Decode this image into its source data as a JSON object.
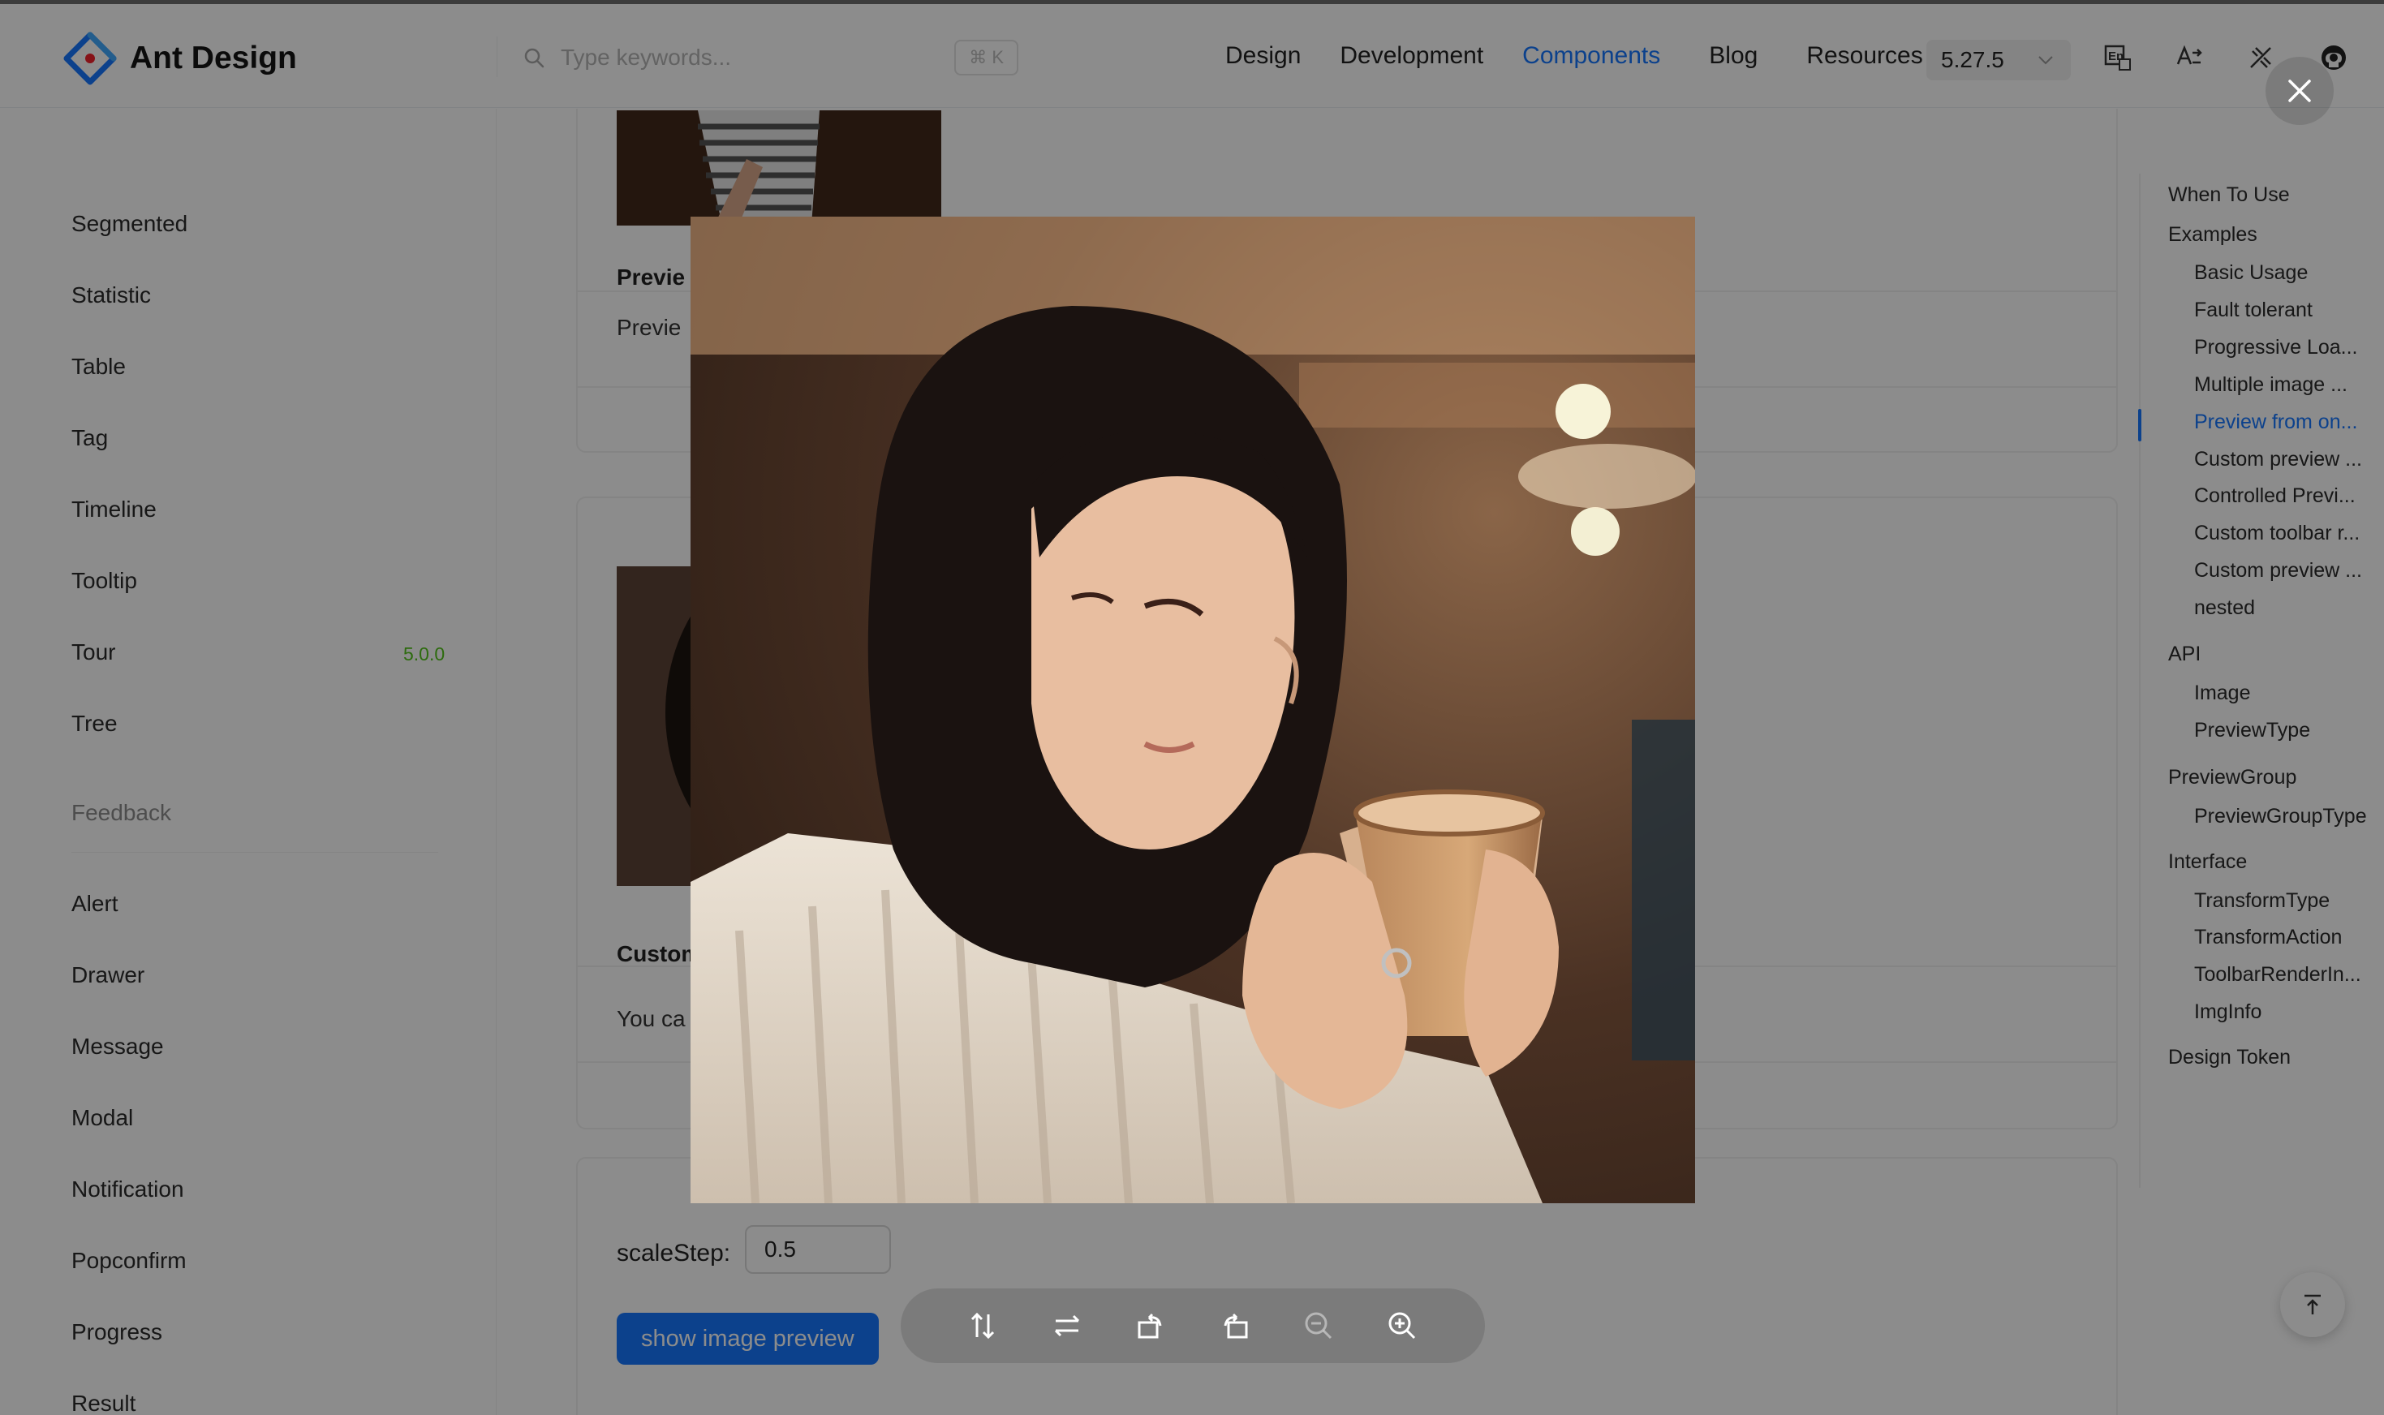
{
  "header": {
    "logo_text": "Ant Design",
    "search_placeholder": "Type keywords...",
    "search_shortcut": "⌘ K",
    "nav": [
      "Design",
      "Development",
      "Components",
      "Blog",
      "Resources"
    ],
    "nav_active": "Components",
    "version": "5.27.5",
    "icons": [
      "language-switch-icon",
      "direction-icon",
      "theme-icon",
      "github-icon"
    ]
  },
  "sidebar": {
    "items": [
      "Segmented",
      "Statistic",
      "Table",
      "Tag",
      "Timeline",
      "Tooltip",
      "Tour",
      "Tree"
    ],
    "tour_badge": "5.0.0",
    "group": "Feedback",
    "feedback_items": [
      "Alert",
      "Drawer",
      "Message",
      "Modal",
      "Notification",
      "Popconfirm",
      "Progress",
      "Result"
    ]
  },
  "content": {
    "demo1": {
      "title": "Previe",
      "desc": "Previe"
    },
    "demo2": {
      "title": "Custom",
      "desc": "You ca"
    },
    "scale_label": "scaleStep:",
    "scale_value": "0.5",
    "preview_button": "show image preview"
  },
  "toc": {
    "items": [
      {
        "label": "When To Use",
        "level": 1
      },
      {
        "label": "Examples",
        "level": 1
      },
      {
        "label": "Basic Usage",
        "level": 2
      },
      {
        "label": "Fault tolerant",
        "level": 2
      },
      {
        "label": "Progressive Loa...",
        "level": 2
      },
      {
        "label": "Multiple image ...",
        "level": 2
      },
      {
        "label": "Preview from on...",
        "level": 2,
        "active": true
      },
      {
        "label": "Custom preview ...",
        "level": 2
      },
      {
        "label": "Controlled Previ...",
        "level": 2
      },
      {
        "label": "Custom toolbar r...",
        "level": 2
      },
      {
        "label": "Custom preview ...",
        "level": 2
      },
      {
        "label": "nested",
        "level": 2
      },
      {
        "label": "API",
        "level": 1
      },
      {
        "label": "Image",
        "level": 2
      },
      {
        "label": "PreviewType",
        "level": 2
      },
      {
        "label": "PreviewGroup",
        "level": 1
      },
      {
        "label": "PreviewGroupType",
        "level": 2
      },
      {
        "label": "Interface",
        "level": 1
      },
      {
        "label": "TransformType",
        "level": 2
      },
      {
        "label": "TransformAction",
        "level": 2
      },
      {
        "label": "ToolbarRenderIn...",
        "level": 2
      },
      {
        "label": "ImgInfo",
        "level": 2
      },
      {
        "label": "Design Token",
        "level": 1
      }
    ]
  },
  "preview": {
    "image_subject": "woman-holding-coffee-cup-photo",
    "toolbar_icons": [
      "flip-vertical-icon",
      "flip-horizontal-icon",
      "rotate-left-icon",
      "rotate-right-icon",
      "zoom-out-icon",
      "zoom-in-icon"
    ],
    "close_icon": "close-icon"
  },
  "colors": {
    "primary": "#1677ff",
    "new_badge": "#52c41a",
    "mask": "rgba(0,0,0,0.45)"
  }
}
